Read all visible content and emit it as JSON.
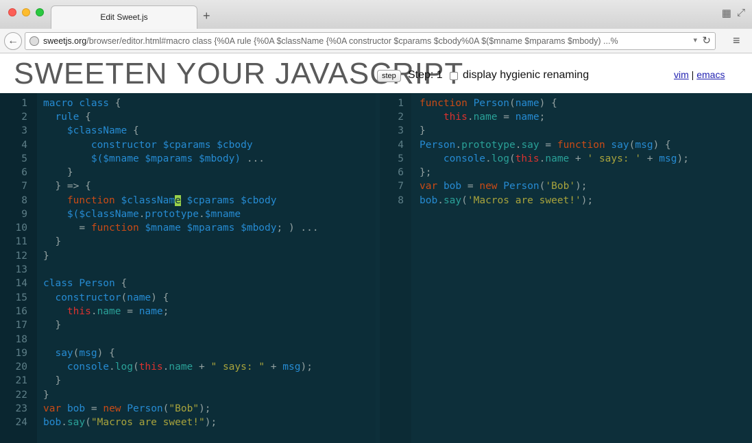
{
  "browser": {
    "tab_title": "Edit Sweet.js",
    "new_tab_icon": "+",
    "url_host": "sweetjs.org",
    "url_path": "/browser/editor.html#macro class {%0A  rule {%0A    $className {%0A        constructor $cparams $cbody%0A        $($mname $mparams $mbody) ...%",
    "url_dropdown_icon": "chevron-down-icon",
    "reload_icon": "reload-icon",
    "menu_icon": "hamburger-icon",
    "back_icon": "back-arrow-icon"
  },
  "header": {
    "brand": "SWEETEN YOUR JAVASCRIPT",
    "step_button": "step",
    "step_label": "Step: 1",
    "hygienic_label": "display hygienic renaming",
    "hygienic_checked": false,
    "link_vim": "vim",
    "link_separator": "|",
    "link_emacs": "emacs"
  },
  "left_editor": {
    "line_numbers": [
      "1",
      "2",
      "3",
      "4",
      "5",
      "6",
      "7",
      "8",
      "9",
      "10",
      "11",
      "12",
      "13",
      "14",
      "15",
      "16",
      "17",
      "18",
      "19",
      "20",
      "21",
      "22",
      "23",
      "24"
    ]
  },
  "right_editor": {
    "line_numbers": [
      "1",
      "2",
      "3",
      "4",
      "5",
      "6",
      "7",
      "8"
    ]
  },
  "colors": {
    "editor_bg": "#0c2d38",
    "keyword": "#cb4b16",
    "identifier": "#268bd2",
    "string": "#a8a33c",
    "cursor": "#9ad14a"
  }
}
